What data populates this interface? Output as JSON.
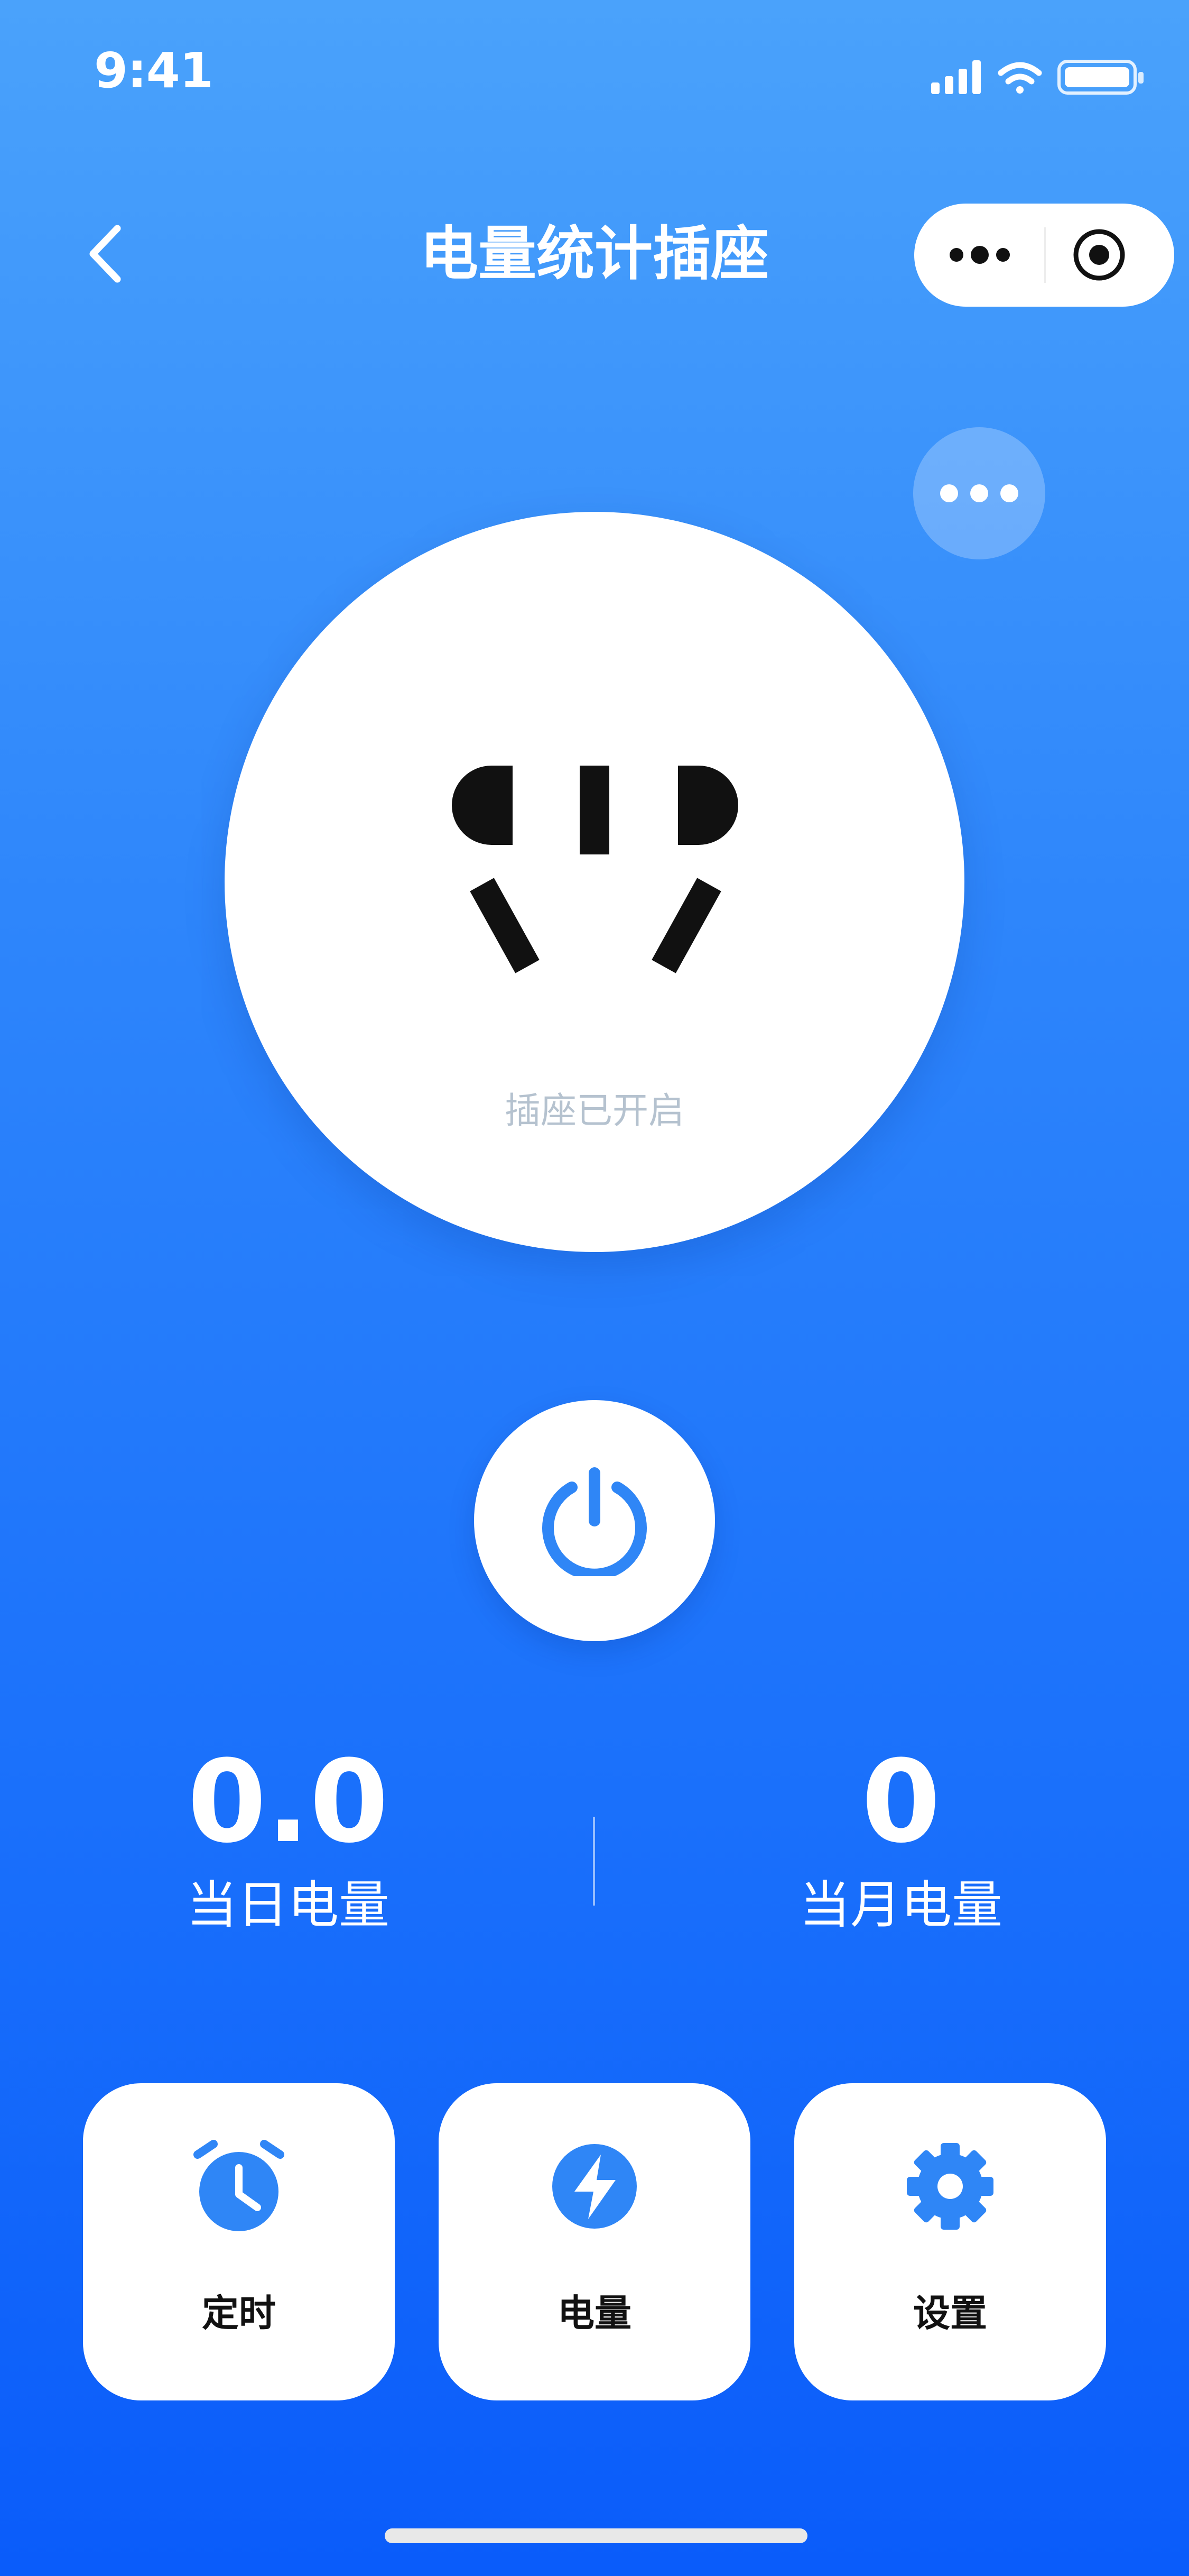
{
  "status_bar": {
    "time": "9:41"
  },
  "nav": {
    "title": "电量统计插座"
  },
  "socket": {
    "status_text": "插座已开启",
    "state": "on"
  },
  "stats": {
    "daily": {
      "value": "0.0",
      "label": "当日电量"
    },
    "monthly": {
      "value": "0",
      "label": "当月电量"
    }
  },
  "actions": [
    {
      "label": "定时",
      "icon": "alarm-clock-icon"
    },
    {
      "label": "电量",
      "icon": "lightning-icon"
    },
    {
      "label": "设置",
      "icon": "gear-icon"
    }
  ],
  "colors": {
    "accent": "#2f86f6",
    "background_top": "#4aa2fb",
    "background_bottom": "#0a5cfa"
  }
}
